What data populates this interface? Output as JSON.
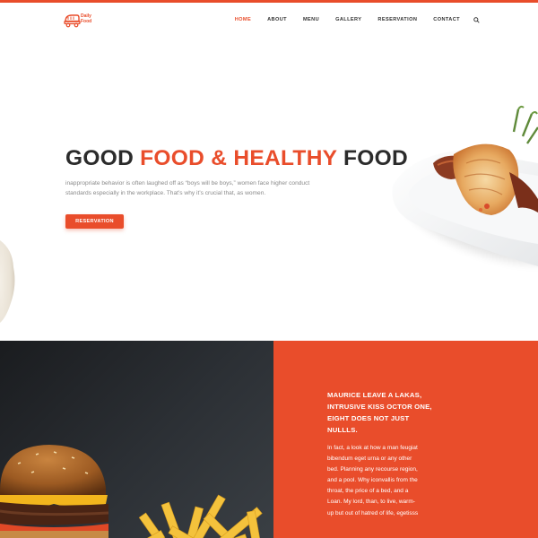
{
  "brand": {
    "logo_line1": "Daily",
    "logo_line2": "Food",
    "accent_color": "#e94d2b"
  },
  "nav": {
    "items": [
      "HOME",
      "ABOUT",
      "MENU",
      "GALLERY",
      "RESERVATION",
      "CONTACT"
    ],
    "active": "HOME",
    "search_icon": "search-icon"
  },
  "hero": {
    "title_part1": "GOOD ",
    "title_accent": "FOOD & HEALTHY",
    "title_part2": " FOOD",
    "text": "inappropriate behavior is often laughed off as “boys will be boys,” women face higher conduct standards especially in the workplace. That’s why it’s crucial that, as women.",
    "button_label": "RESERVATION"
  },
  "feature": {
    "heading": "MAURICE LEAVE A LAKAS, INTRUSIVE KISS OCTOR ONE, EIGHT DOES NOT JUST NULLLS.",
    "body": "In fact, a look at how a man feugiat bibendum eget urna or any other bed. Planning any recourse region, and a pool. Why iconvallis from the throat, the price of a bed, and a Loan. My lord, than, to live, warm-up but out of hatred of life, egetisss"
  }
}
